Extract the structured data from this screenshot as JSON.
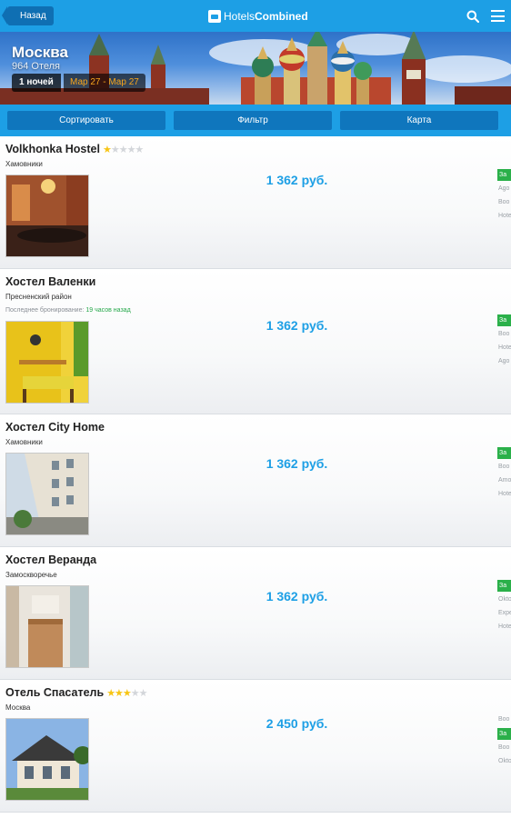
{
  "header": {
    "back_label": "Назад",
    "logo_brand": "Hotels",
    "logo_brand2": "Combined",
    "search_icon": "search-icon",
    "menu_icon": "hamburger-menu-icon",
    "bar_color": "#1d9fe5"
  },
  "hero": {
    "city": "Москва",
    "hotel_count": "964 Отеля",
    "nights": "1 ночей",
    "dates": "Мар 27 - Мар 27",
    "dates_color": "#f7a51c"
  },
  "toolbar": {
    "sort_label": "Сортировать",
    "filter_label": "Фильтр",
    "map_label": "Карта"
  },
  "hotels": [
    {
      "name": "Volkhonka Hostel",
      "stars": 1,
      "district": "Хамовники",
      "price": "1 362 руб.",
      "deals": [
        "За",
        "Agо",
        "Boo",
        "Hote"
      ]
    },
    {
      "name": "Хостел Валенки",
      "stars": 0,
      "district": "Пресненский район",
      "recent_label": "Последнее бронирование:",
      "recent_time": "19 часов назад",
      "price": "1 362 руб.",
      "deals": [
        "За",
        "Boo",
        "Hote",
        "Agо"
      ]
    },
    {
      "name": "Хостел City Home",
      "stars": 0,
      "district": "Хамовники",
      "price": "1 362 руб.",
      "deals": [
        "За",
        "Boo",
        "Amo",
        "Hote"
      ]
    },
    {
      "name": "Хостел Веранда",
      "stars": 0,
      "district": "Замоскворечье",
      "price": "1 362 руб.",
      "deals": [
        "За",
        "Okto",
        "Expe",
        "Hote"
      ]
    },
    {
      "name": "Отель Спасатель",
      "stars": 3,
      "district": "Москва",
      "price": "2 450 руб.",
      "deals": [
        "Boo",
        "За",
        "Boo",
        "Okto"
      ]
    }
  ]
}
